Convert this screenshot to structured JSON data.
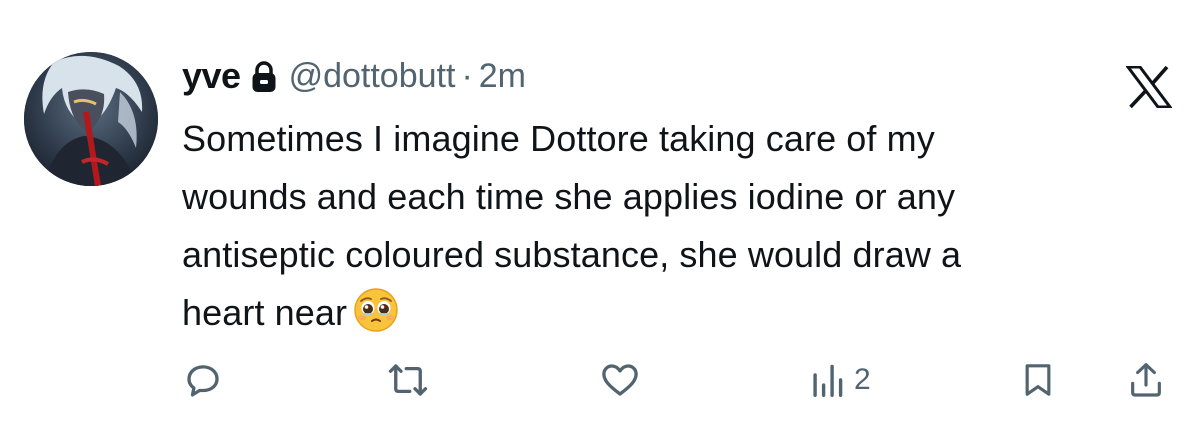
{
  "tweet": {
    "display_name": "yve",
    "handle": "@dottobutt",
    "separator": "·",
    "time": "2m",
    "lines": [
      "Sometimes I imagine Dottore taking care of my",
      "wounds and each time she applies iodine or any",
      "antiseptic coloured substance, she would draw a",
      "heart near"
    ],
    "emoji": "🥹"
  },
  "actions": {
    "reply_count": "",
    "retweet_count": "",
    "like_count": "",
    "views_count": "2"
  },
  "icons": {
    "lock": "lock-icon",
    "brand": "x-logo-icon",
    "reply": "reply-icon",
    "retweet": "retweet-icon",
    "like": "heart-icon",
    "views": "views-icon",
    "bookmark": "bookmark-icon",
    "share": "share-icon"
  },
  "colors": {
    "text_primary": "#0f1419",
    "text_secondary": "#536471",
    "background": "#ffffff"
  }
}
